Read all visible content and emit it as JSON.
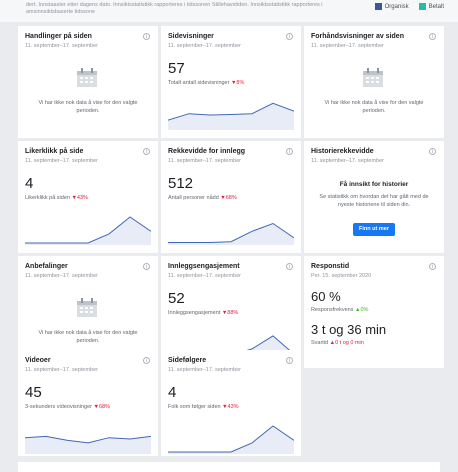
{
  "header": {
    "text": "dert. Innstaaster etter dagens dato. Innsiktsstatistikk rapporteres i tidssonen Stillehavstiden. Innsiktsstatistikk rapporteres i amsinnsiktsbaserte tidssone",
    "legend": [
      {
        "label": "Organisk",
        "color": "#3b5998"
      },
      {
        "label": "Betalt",
        "color": "#2abba7"
      }
    ]
  },
  "period": "11. september–17. september",
  "no_data_text": "Vi har ikke nok data å vise for den valgte perioden.",
  "cards": {
    "handlinger": {
      "title": "Handlinger på siden",
      "sub": "11. september–17. september"
    },
    "sidevisninger": {
      "title": "Sidevisninger",
      "sub": "11. september–17. september",
      "value": "57",
      "desc": "Totalt antall sidevisninger",
      "change": "▼8%"
    },
    "forhands": {
      "title": "Forhåndsvisninger av siden",
      "sub": "11. september–17. september"
    },
    "likerklikk": {
      "title": "Likerklikk på side",
      "sub": "11. september–17. september",
      "value": "4",
      "desc": "Likerklikk på siden",
      "change": "▼43%"
    },
    "rekkevidde": {
      "title": "Rekkevidde for innlegg",
      "sub": "11. september–17. september",
      "value": "512",
      "desc": "Antall personer nådd",
      "change": "▼68%"
    },
    "historie": {
      "title": "Historierekkevidde",
      "sub": "11. september–17. september",
      "heading": "Få innsikt for historier",
      "body": "Se statistikk om hvordan det har gått med de nyeste historiene til siden din.",
      "button": "Finn ut mer"
    },
    "anbefalinger": {
      "title": "Anbefalinger",
      "sub": "11. september–17. september"
    },
    "engasjement": {
      "title": "Innleggsengasjement",
      "sub": "11. september–17. september",
      "value": "52",
      "desc": "Innleggsengasjement",
      "change": "▼88%"
    },
    "responstid": {
      "title": "Responstid",
      "sub": "Per. 15. september 2020",
      "pct": "60 %",
      "pct_desc": "Responsfrekvens",
      "pct_change": "▲0%",
      "time": "3 t og 36 min",
      "time_desc": "Svartid",
      "time_change": "▲0 t og 0 min"
    },
    "videoer": {
      "title": "Videoer",
      "sub": "11. september–17. september",
      "value": "45",
      "desc": "3-sekunders videovisninger",
      "change": "▼68%"
    },
    "sidefolgere": {
      "title": "Sidefølgere",
      "sub": "11. september–17. september",
      "value": "4",
      "desc": "Folk som følger siden",
      "change": "▼43%"
    }
  },
  "sparklines": {
    "sidevisninger": [
      0.3,
      0.55,
      0.5,
      0.52,
      0.55,
      0.95,
      0.65
    ],
    "likerklikk": [
      0.0,
      0.0,
      0.0,
      0.0,
      0.35,
      1.0,
      0.45
    ],
    "rekkevidde": [
      0.02,
      0.02,
      0.02,
      0.05,
      0.45,
      0.75,
      0.2
    ],
    "engasjement": [
      0.05,
      0.05,
      0.08,
      0.1,
      0.35,
      0.85,
      0.15
    ],
    "videoer": [
      0.55,
      0.6,
      0.45,
      0.35,
      0.55,
      0.5,
      0.6
    ],
    "sidefolgere": [
      0.0,
      0.0,
      0.0,
      0.0,
      0.35,
      1.0,
      0.45
    ]
  }
}
